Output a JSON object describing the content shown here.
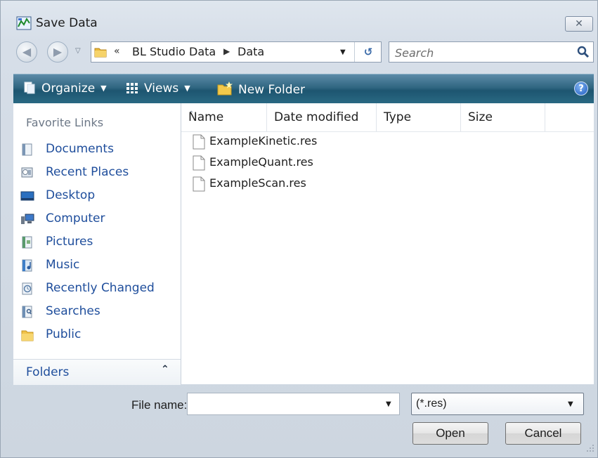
{
  "window": {
    "title": "Save Data",
    "close_label": "☒"
  },
  "address": {
    "crumbs": [
      "BL Studio Data",
      "Data"
    ],
    "overflow": "«"
  },
  "search": {
    "placeholder": "Search"
  },
  "toolbar": {
    "organize": "Organize",
    "views": "Views",
    "new_folder": "New Folder"
  },
  "favorites": {
    "title": "Favorite Links",
    "items": [
      {
        "label": "Documents",
        "icon": "documents-icon"
      },
      {
        "label": "Recent Places",
        "icon": "recent-places-icon"
      },
      {
        "label": "Desktop",
        "icon": "desktop-icon"
      },
      {
        "label": "Computer",
        "icon": "computer-icon"
      },
      {
        "label": "Pictures",
        "icon": "pictures-icon"
      },
      {
        "label": "Music",
        "icon": "music-icon"
      },
      {
        "label": "Recently Changed",
        "icon": "recently-changed-icon"
      },
      {
        "label": "Searches",
        "icon": "searches-icon"
      },
      {
        "label": "Public",
        "icon": "public-folder-icon"
      }
    ],
    "folders_label": "Folders"
  },
  "columns": [
    "Name",
    "Date modified",
    "Type",
    "Size"
  ],
  "files": [
    "ExampleKinetic.res",
    "ExampleQuant.res",
    "ExampleScan.res"
  ],
  "bottom": {
    "file_name_label": "File name:",
    "file_name_value": "",
    "file_type_value": "(*.res)",
    "open_label": "Open",
    "cancel_label": "Cancel"
  },
  "colors": {
    "toolbar": "#2f6580",
    "link": "#1f4e9c"
  }
}
